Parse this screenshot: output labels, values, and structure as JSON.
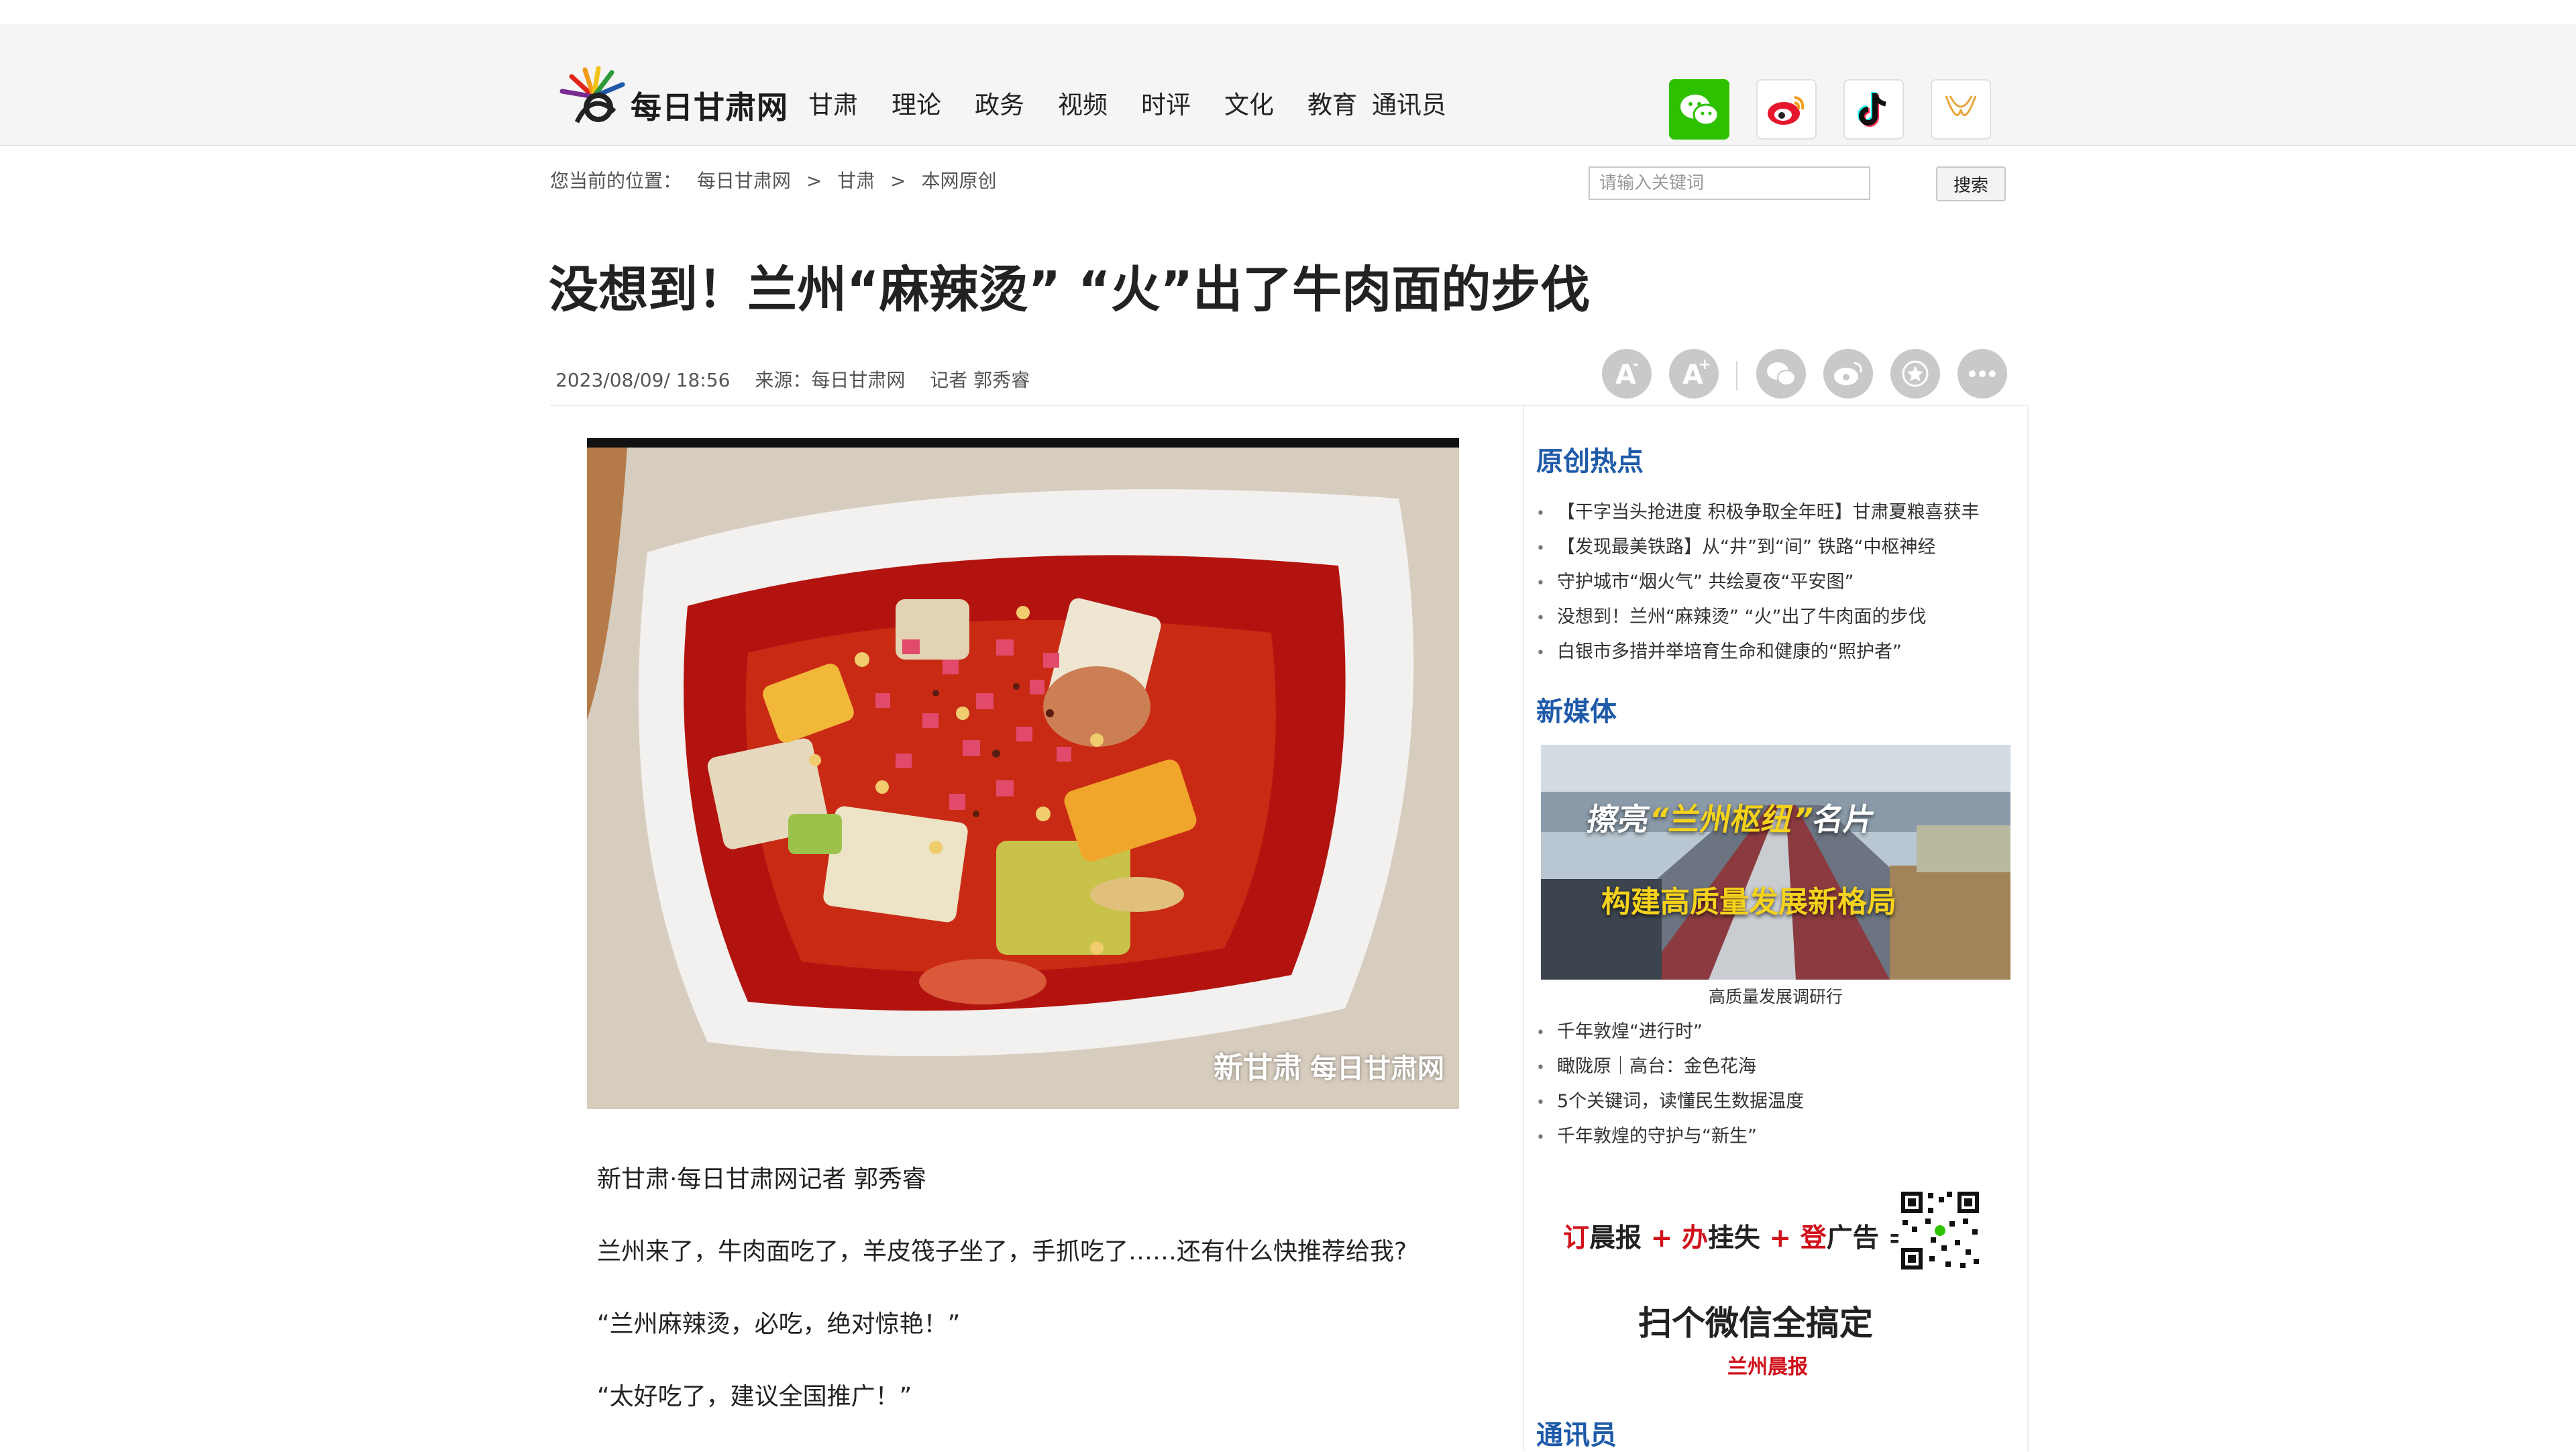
{
  "site": {
    "logo_text": "每日甘肃网"
  },
  "nav": [
    "甘肃",
    "理论",
    "政务",
    "视频",
    "时评",
    "文化",
    "教育",
    "通讯员"
  ],
  "social": [
    "wechat-icon",
    "weibo-icon",
    "douyin-icon",
    "mini-program-icon"
  ],
  "breadcrumb": {
    "label": "您当前的位置：",
    "items": [
      "每日甘肃网",
      "甘肃",
      "本网原创"
    ],
    "separator": ">"
  },
  "search": {
    "placeholder": "请输入关键词",
    "button": "搜索"
  },
  "article": {
    "title": "没想到！兰州“麻辣烫” “火”出了牛肉面的步伐",
    "date": "2023/08/09/ 18:56",
    "source": "来源：每日甘肃网",
    "reporter": "记者 郭秀睿",
    "photo_watermark": "新甘肃",
    "photo_watermark_site": "每日甘肃网",
    "paragraphs": [
      "新甘肃·每日甘肃网记者 郭秀睿",
      "兰州来了，牛肉面吃了，羊皮筏子坐了，手抓吃了……还有什么快推荐给我?",
      "“兰州麻辣烫，必吃，绝对惊艳！”",
      "“太好吃了，建议全国推广！”"
    ]
  },
  "toolbar": [
    "font-decrease-icon",
    "font-increase-icon",
    "wechat-share-icon",
    "weibo-share-icon",
    "favorite-icon",
    "more-icon"
  ],
  "sidebar": {
    "hot_title": "原创热点",
    "hot_items": [
      "【干字当头抢进度 积极争取全年旺】甘肃夏粮喜获丰",
      "【发现最美铁路】从“井”到“间” 铁路“中枢神经",
      "守护城市“烟火气” 共绘夏夜“平安图”",
      "没想到！兰州“麻辣烫” “火”出了牛肉面的步伐",
      "白银市多措并举培育生命和健康的“照护者”"
    ],
    "media_title": "新媒体",
    "media_image_line1_a": "擦亮",
    "media_image_line1_b": "“兰州枢纽”",
    "media_image_line1_c": "名片",
    "media_image_line2": "构建高质量发展新格局",
    "media_caption": "高质量发展调研行",
    "media_items": [
      "千年敦煌“进行时”",
      "瞰陇原｜高台：金色花海",
      "5个关键词，读懂民生数据温度",
      "千年敦煌的守护与“新生”"
    ],
    "ad_parts": [
      "订",
      "晨报",
      " + ",
      "办",
      "挂失",
      " + ",
      "登",
      "广告",
      " ="
    ],
    "ad_line2": "扫个微信全搞定",
    "ad_logo": "兰州晨报",
    "reporter_title": "通讯员"
  },
  "colors": {
    "accent": "#1e5aa8",
    "ad_red": "#d0101a",
    "wechat_green": "#2dc100"
  }
}
